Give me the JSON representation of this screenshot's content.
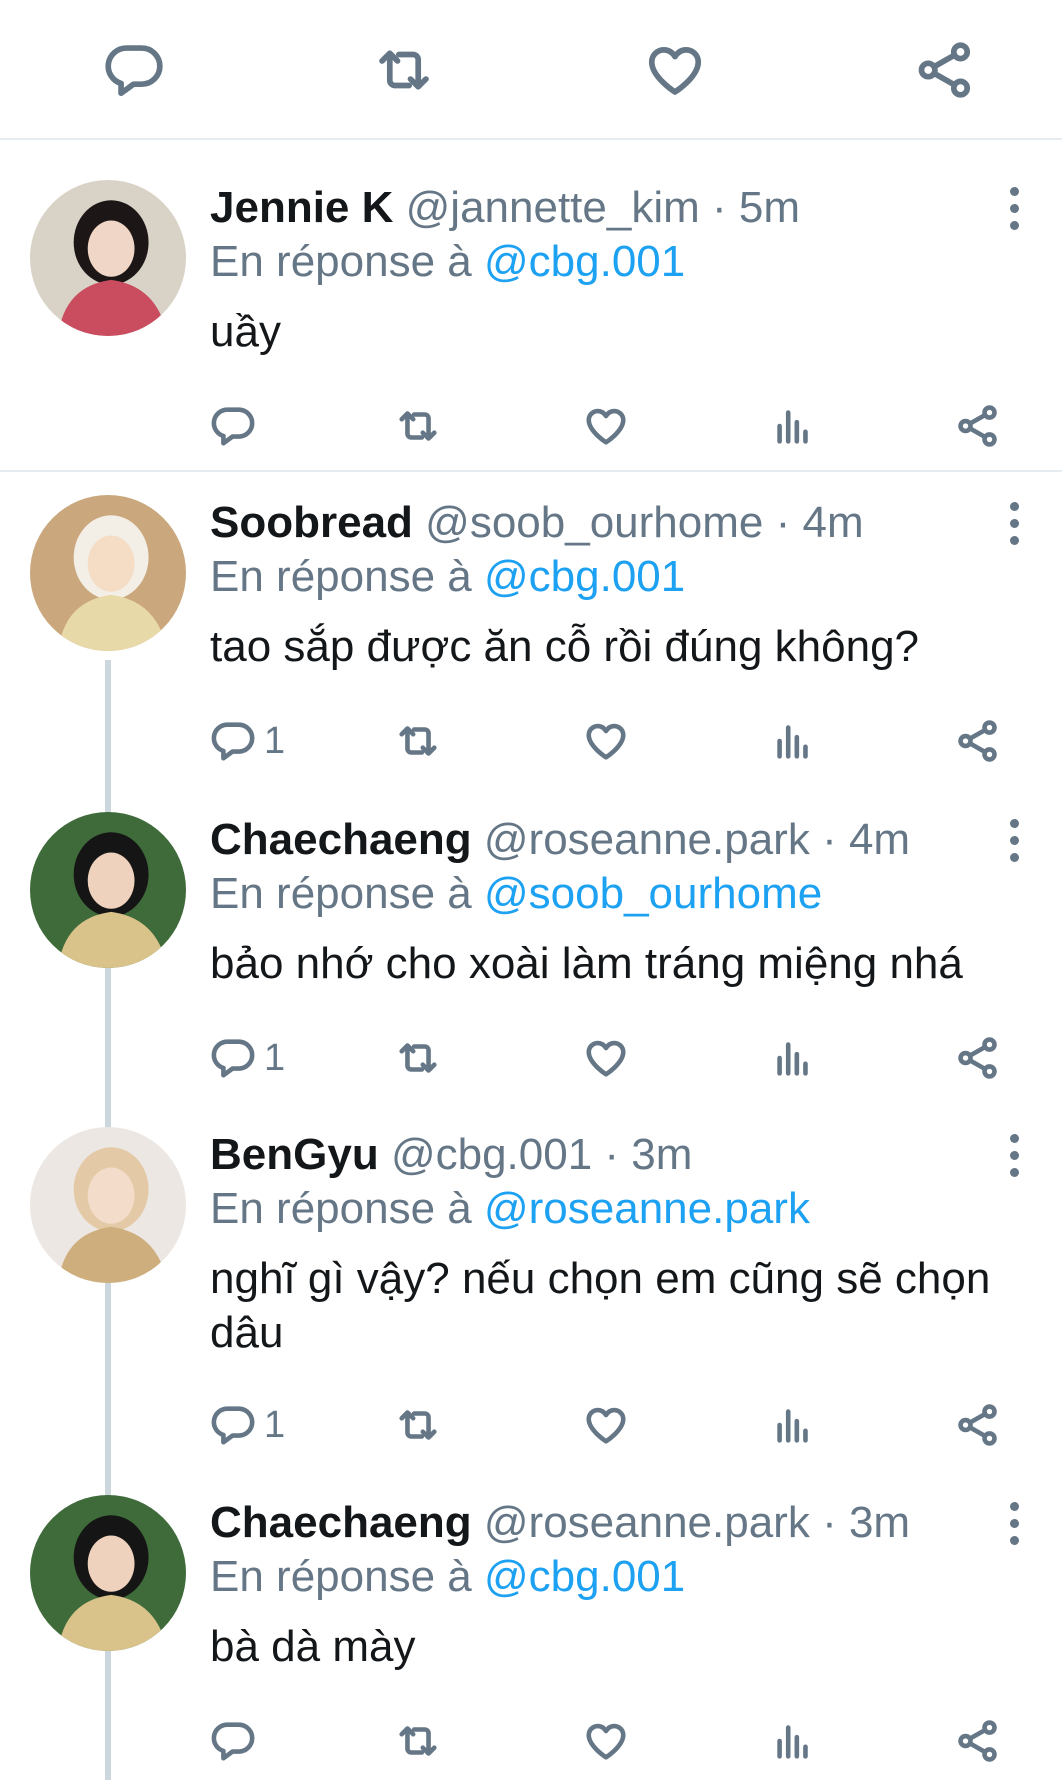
{
  "top_actions": {
    "icons": [
      "reply-icon",
      "retweet-icon",
      "like-icon",
      "share-icon"
    ]
  },
  "replies_label": "En réponse à",
  "tweets": [
    {
      "name": "Jennie K",
      "handle": "@jannette_kim",
      "time": "5m",
      "reply_to": "@cbg.001",
      "text": "uầy",
      "reply_count": "",
      "avatar_colors": [
        "#d9d2c7",
        "#1c1716",
        "#f0d6c6",
        "#c94d5e"
      ]
    },
    {
      "name": "Soobread",
      "handle": "@soob_ourhome",
      "time": "4m",
      "reply_to": "@cbg.001",
      "text": "tao sắp được ăn cỗ rồi đúng không?",
      "reply_count": "1",
      "avatar_colors": [
        "#caa77c",
        "#f3eee6",
        "#f5dcc4",
        "#e8d9a8"
      ]
    },
    {
      "name": "Chaechaeng",
      "handle": "@roseanne.park",
      "time": "4m",
      "reply_to": "@soob_ourhome",
      "text": "bảo nhớ cho xoài làm tráng miệng nhá",
      "reply_count": "1",
      "avatar_colors": [
        "#3f6b3a",
        "#151515",
        "#efd2bd",
        "#d9c38a"
      ]
    },
    {
      "name": "BenGyu",
      "handle": "@cbg.001",
      "time": "3m",
      "reply_to": "@roseanne.park",
      "text": "nghĩ gì vậy? nếu chọn em cũng sẽ chọn dâu",
      "reply_count": "1",
      "avatar_colors": [
        "#ece7e2",
        "#e3c9a6",
        "#f4dccb",
        "#cfae7e"
      ]
    },
    {
      "name": "Chaechaeng",
      "handle": "@roseanne.park",
      "time": "3m",
      "reply_to": "@cbg.001",
      "text": "bà dà mày",
      "reply_count": "",
      "avatar_colors": [
        "#3f6b3a",
        "#151515",
        "#efd2bd",
        "#d9c38a"
      ]
    }
  ],
  "colors": {
    "accent": "#1da1f2",
    "muted": "#657786",
    "divider": "#e6ecf0",
    "thread": "#ccd6dd"
  }
}
